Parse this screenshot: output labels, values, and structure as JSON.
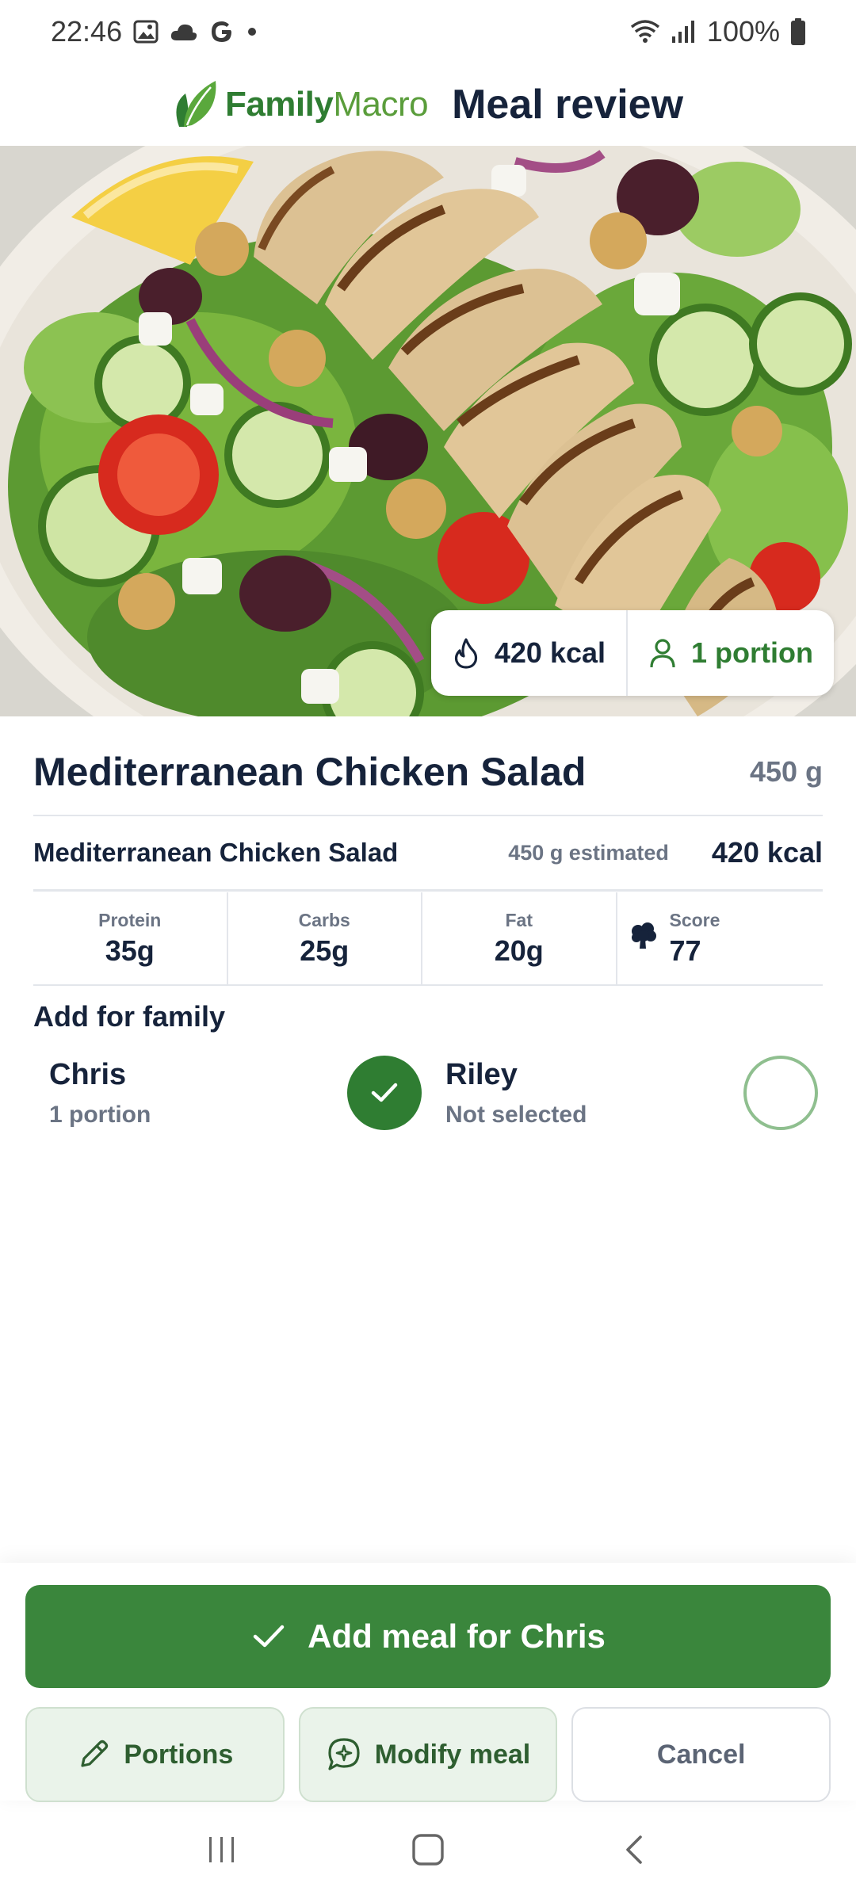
{
  "status_bar": {
    "time": "22:46",
    "battery": "100%",
    "icons": [
      "image-icon",
      "cloud-icon",
      "google-icon",
      "dot-icon",
      "wifi-icon",
      "signal-icon",
      "battery-icon"
    ]
  },
  "header": {
    "brand_part1": "Family",
    "brand_part2": "Macro",
    "title": "Meal review"
  },
  "hero": {
    "calories": "420 kcal",
    "portion": "1 portion"
  },
  "meal": {
    "title": "Mediterranean Chicken Salad",
    "weight": "450 g",
    "item": {
      "name": "Mediterranean Chicken Salad",
      "estimate": "450 g estimated",
      "kcal": "420 kcal"
    },
    "macros": [
      {
        "label": "Protein",
        "value": "35g"
      },
      {
        "label": "Carbs",
        "value": "25g"
      },
      {
        "label": "Fat",
        "value": "20g"
      },
      {
        "label": "Score",
        "value": "77"
      }
    ]
  },
  "family": {
    "title": "Add for family",
    "members": [
      {
        "name": "Chris",
        "status": "1 portion",
        "selected": true
      },
      {
        "name": "Riley",
        "status": "Not selected",
        "selected": false
      }
    ]
  },
  "actions": {
    "primary": "Add meal for Chris",
    "portions": "Portions",
    "modify": "Modify meal",
    "cancel": "Cancel"
  },
  "colors": {
    "brand_green": "#3a863c",
    "text_dark": "#16233b",
    "text_muted": "#6b7484"
  }
}
